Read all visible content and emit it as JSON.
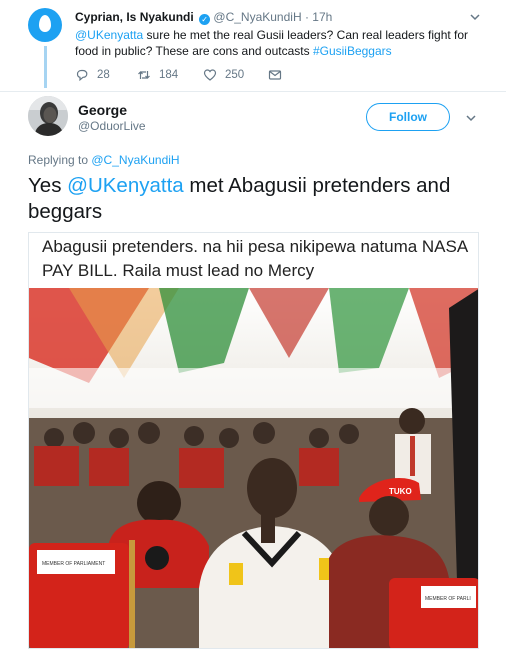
{
  "parent_tweet": {
    "author_name": "Cyprian, Is Nyakundi",
    "verified_mark": "✓",
    "handle": "@C_NyaKundiH",
    "separator": "·",
    "time": "17h",
    "text_mention": "@UKenyatta",
    "text_body": " sure he met the real Gusii leaders? Can real leaders fight for food in public? These are cons and outcasts ",
    "text_hashtag": "#GusiiBeggars",
    "replies": "28",
    "retweets": "184",
    "likes": "250",
    "icons": [
      "reply-icon",
      "retweet-icon",
      "like-icon",
      "message-icon",
      "chevron-down-icon"
    ]
  },
  "tweet": {
    "author_name": "George",
    "handle": "@OduorLive",
    "follow_label": "Follow",
    "replying_prefix": "Replying to ",
    "replying_to": "@C_NyaKundiH",
    "text_prefix": "Yes ",
    "text_mention": "@UKenyatta",
    "text_suffix": " met Abagusii pretenders and beggars"
  },
  "media": {
    "caption": "Abagusii pretenders. na hii pesa nikipewa natuma NASA PAY BILL. Raila must lead no Mercy",
    "cap_badge_text": "TUKO",
    "seat_label_left": "MEMBER OF PARLIAMENT",
    "seat_label_right": "MEMBER OF PARLI"
  },
  "colors": {
    "accent": "#1da1f2",
    "text": "#14171a",
    "muted": "#657786",
    "thread_line": "#a6d4f2",
    "divider": "#e6ecf0"
  }
}
